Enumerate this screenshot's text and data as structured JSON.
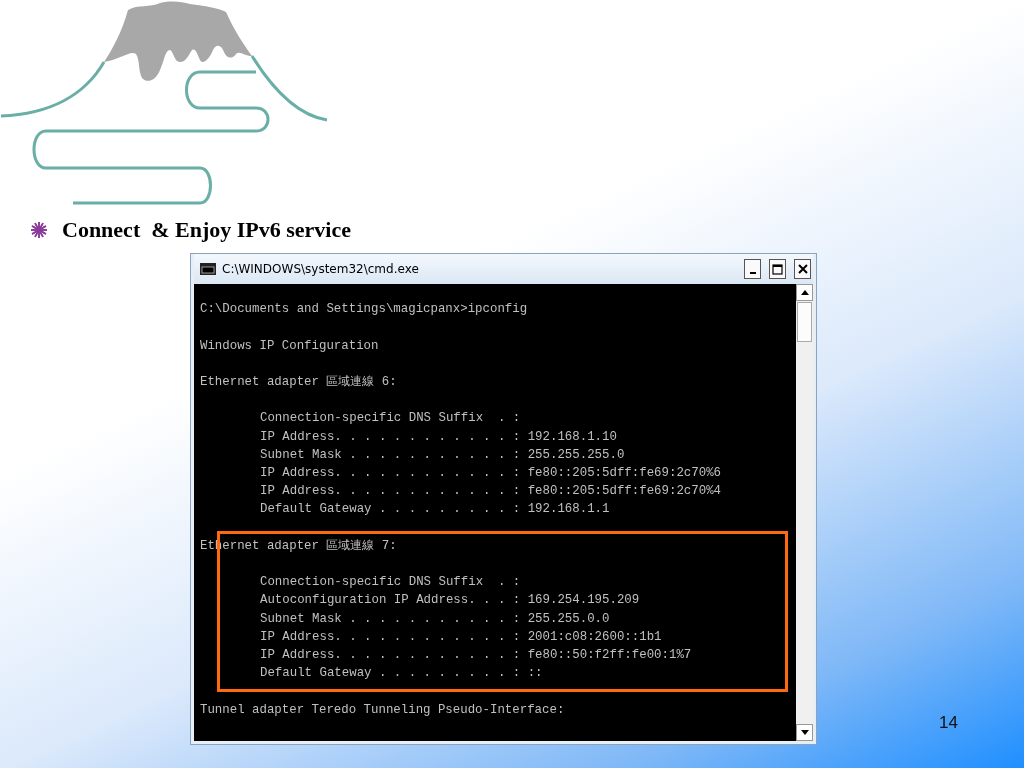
{
  "slide": {
    "bullet": "Connect  & Enjoy IPv6 service",
    "page_number": "14"
  },
  "window": {
    "title": "C:\\WINDOWS\\system32\\cmd.exe"
  },
  "console": {
    "groups": [
      {
        "highlighted": false,
        "lines": [
          {
            "kind": "command",
            "text": "C:\\Documents and Settings\\magicpanx>ipconfig"
          },
          {
            "kind": "title",
            "text": "Windows IP Configuration"
          },
          {
            "kind": "adapter",
            "text": "Ethernet adapter 區域連線 6:"
          },
          {
            "kind": "setting",
            "text": "Connection-specific DNS Suffix  . :"
          },
          {
            "kind": "setting",
            "text": "IP Address. . . . . . . . . . . . : 192.168.1.10"
          },
          {
            "kind": "setting",
            "text": "Subnet Mask . . . . . . . . . . . : 255.255.255.0"
          },
          {
            "kind": "setting",
            "text": "IP Address. . . . . . . . . . . . : fe80::205:5dff:fe69:2c70%6"
          },
          {
            "kind": "setting",
            "text": "IP Address. . . . . . . . . . . . : fe80::205:5dff:fe69:2c70%4"
          },
          {
            "kind": "setting",
            "text": "Default Gateway . . . . . . . . . : 192.168.1.1"
          }
        ]
      },
      {
        "highlighted": true,
        "lines": [
          {
            "kind": "adapter",
            "text": "Ethernet adapter 區域連線 7:"
          },
          {
            "kind": "setting",
            "text": "Connection-specific DNS Suffix  . :"
          },
          {
            "kind": "setting",
            "text": "Autoconfiguration IP Address. . . : 169.254.195.209"
          },
          {
            "kind": "setting",
            "text": "Subnet Mask . . . . . . . . . . . : 255.255.0.0"
          },
          {
            "kind": "setting",
            "text": "IP Address. . . . . . . . . . . . : 2001:c08:2600::1b1"
          },
          {
            "kind": "setting",
            "text": "IP Address. . . . . . . . . . . . : fe80::50:f2ff:fe00:1%7"
          },
          {
            "kind": "setting",
            "text": "Default Gateway . . . . . . . . . : ::"
          }
        ]
      },
      {
        "highlighted": false,
        "lines": [
          {
            "kind": "adapter",
            "text": "Tunnel adapter Teredo Tunneling Pseudo-Interface:"
          }
        ]
      }
    ]
  }
}
